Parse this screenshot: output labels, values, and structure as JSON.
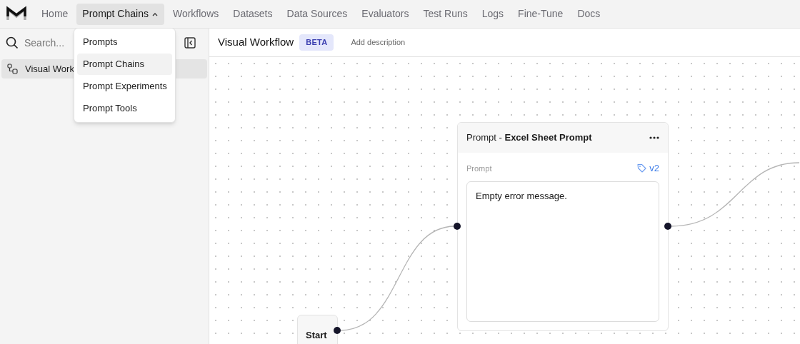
{
  "nav": {
    "items": [
      {
        "label": "Home",
        "selected": false,
        "has_menu": false
      },
      {
        "label": "Prompt Chains",
        "selected": true,
        "has_menu": true
      },
      {
        "label": "Workflows",
        "selected": false,
        "has_menu": false
      },
      {
        "label": "Datasets",
        "selected": false,
        "has_menu": false
      },
      {
        "label": "Data Sources",
        "selected": false,
        "has_menu": false
      },
      {
        "label": "Evaluators",
        "selected": false,
        "has_menu": false
      },
      {
        "label": "Test Runs",
        "selected": false,
        "has_menu": false
      },
      {
        "label": "Logs",
        "selected": false,
        "has_menu": false
      },
      {
        "label": "Fine-Tune",
        "selected": false,
        "has_menu": false
      },
      {
        "label": "Docs",
        "selected": false,
        "has_menu": false
      }
    ]
  },
  "dropdown": {
    "items": [
      {
        "label": "Prompts",
        "selected": false
      },
      {
        "label": "Prompt Chains",
        "selected": true
      },
      {
        "label": "Prompt Experiments",
        "selected": false
      },
      {
        "label": "Prompt Tools",
        "selected": false
      }
    ]
  },
  "sidebar": {
    "search": {
      "placeholder": "Search..."
    },
    "items": [
      {
        "label": "Visual Work",
        "selected": true
      }
    ]
  },
  "header": {
    "title": "Visual Workflow",
    "badge": "BETA",
    "description": {
      "placeholder": "Add description"
    }
  },
  "canvas": {
    "nodes": [
      {
        "kind": "prompt",
        "type_label": "Prompt - ",
        "name": "Excel Sheet Prompt",
        "field_label": "Prompt",
        "version": "v2",
        "text": "Empty error message."
      },
      {
        "kind": "start",
        "name": "Start"
      }
    ]
  }
}
